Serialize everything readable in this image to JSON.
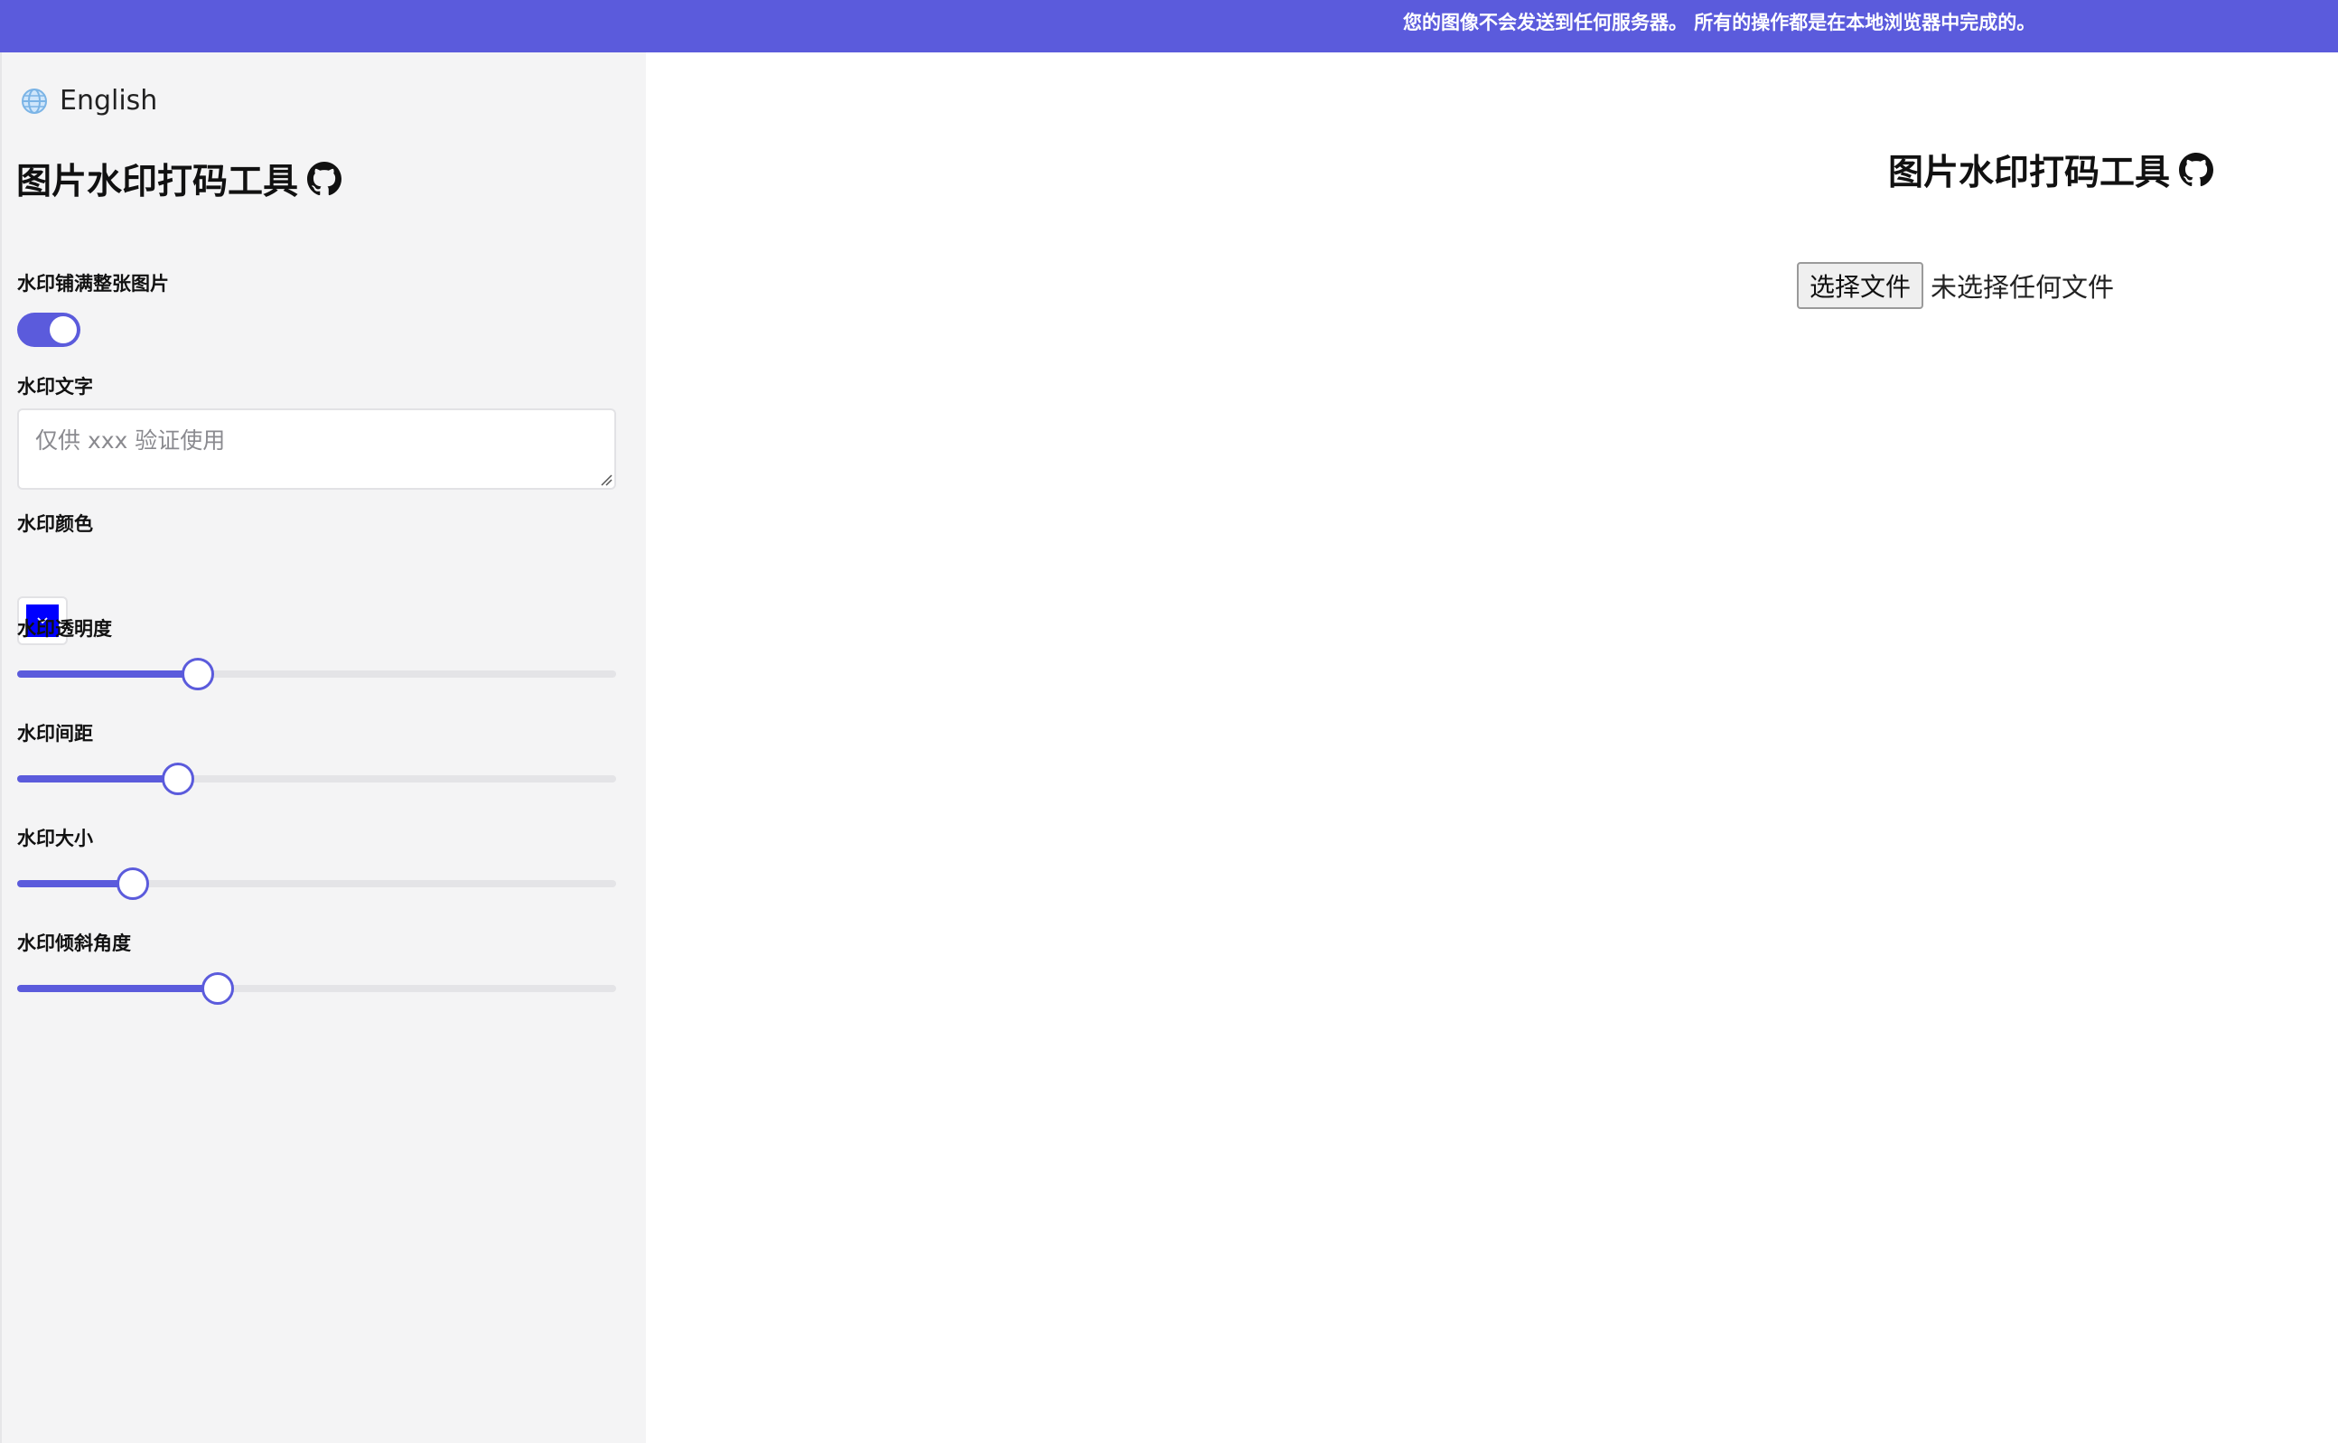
{
  "banner": {
    "message": "您的图像不会发送到任何服务器。 所有的操作都是在本地浏览器中完成的。"
  },
  "sidebar": {
    "language": {
      "label": "English",
      "icon": "globe-icon"
    },
    "title": "图片水印打码工具",
    "title_icon": "github-icon",
    "tile_full": {
      "label": "水印铺满整张图片",
      "checked": true
    },
    "watermark_text": {
      "label": "水印文字",
      "value": "",
      "placeholder": "仅供 xxx 验证使用"
    },
    "watermark_color": {
      "label": "水印颜色",
      "value": "#0000ff"
    },
    "sliders": [
      {
        "key": "opacity",
        "label": "水印透明度",
        "fraction": 0.3
      },
      {
        "key": "spacing",
        "label": "水印间距",
        "fraction": 0.267
      },
      {
        "key": "size",
        "label": "水印大小",
        "fraction": 0.192
      },
      {
        "key": "angle",
        "label": "水印倾斜角度",
        "fraction": 0.334
      }
    ]
  },
  "main": {
    "title": "图片水印打码工具",
    "title_icon": "github-icon",
    "file_button_label": "选择文件",
    "file_status": "未选择任何文件"
  },
  "colors": {
    "accent": "#5b5bdc",
    "sidebar_bg": "#f4f4f5",
    "track": "#e4e4e7"
  }
}
